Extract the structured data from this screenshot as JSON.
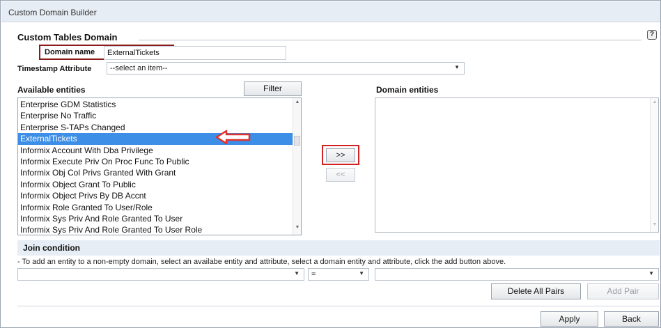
{
  "window": {
    "title": "Custom Domain Builder"
  },
  "section": {
    "title": "Custom Tables Domain",
    "help_glyph": "?"
  },
  "domain_name": {
    "label": "Domain name",
    "value": "ExternalTickets"
  },
  "timestamp": {
    "label": "Timestamp Attribute",
    "selected": "--select an item--"
  },
  "available": {
    "title": "Available entities",
    "filter_label": "Filter",
    "items": [
      "Enterprise GDM Statistics",
      "Enterprise No Traffic",
      "Enterprise S-TAPs Changed",
      "ExternalTickets",
      "Informix Account With Dba Privilege",
      "Informix Execute Priv On Proc Func To Public",
      "Informix Obj Col Privs Granted With Grant",
      "Informix Object Grant To Public",
      "Informix Object Privs By DB Accnt",
      "Informix Role Granted To User/Role",
      "Informix Sys Priv And Role Granted To User",
      "Informix Sys Priv And Role Granted To User Role"
    ],
    "selected_item": "ExternalTickets"
  },
  "transfer": {
    "add_label": ">>",
    "remove_label": "<<"
  },
  "domain_entities": {
    "title": "Domain entities"
  },
  "join": {
    "title": "Join condition",
    "hint": "- To add an entity to a non-empty domain, select an availabe entity and attribute, select a domain entity and attribute, click the add button above.",
    "left_value": "",
    "operator": "=",
    "right_value": ""
  },
  "buttons": {
    "delete_all_pairs": "Delete All Pairs",
    "add_pair": "Add Pair",
    "apply": "Apply",
    "back": "Back"
  },
  "colors": {
    "selection": "#3d8ee6",
    "highlight_box": "#d32222",
    "outline_box": "#8b1a1a",
    "arrow": "#e0322b"
  }
}
